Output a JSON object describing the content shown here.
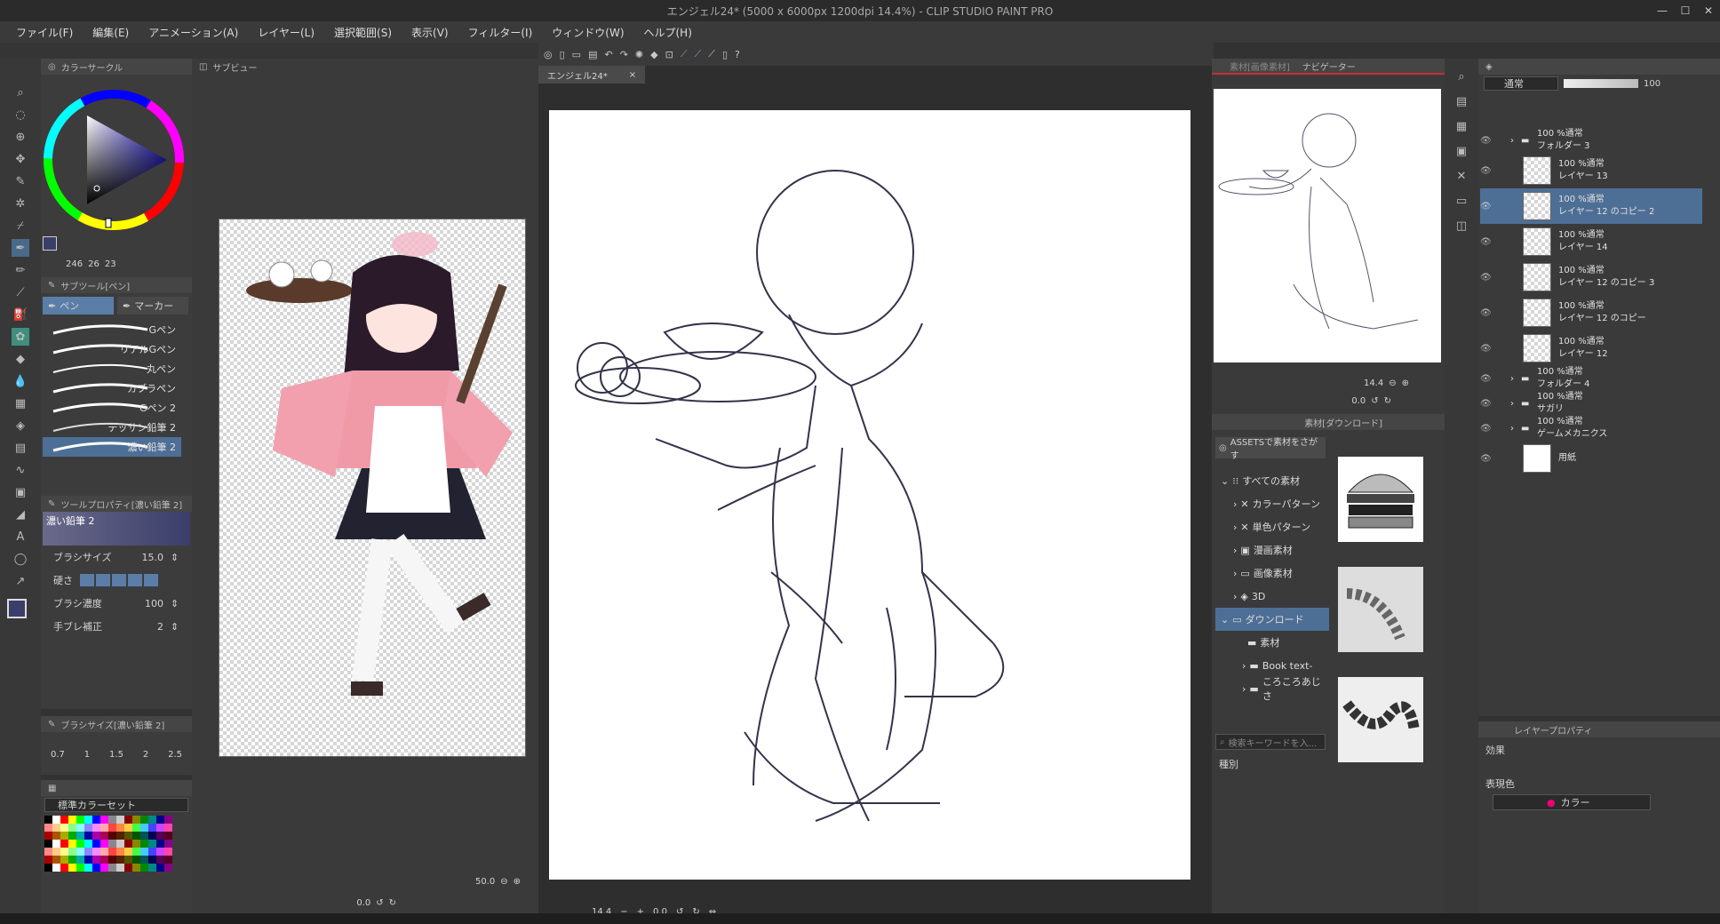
{
  "window": {
    "title": "エンジェル24* (5000 x 6000px 1200dpi 14.4%) - CLIP STUDIO PAINT PRO",
    "min": "—",
    "max": "☐",
    "close": "✕"
  },
  "menu": [
    "ファイル(F)",
    "編集(E)",
    "アニメーション(A)",
    "レイヤー(L)",
    "選択範囲(S)",
    "表示(V)",
    "フィルター(I)",
    "ウィンドウ(W)",
    "ヘルプ(H)"
  ],
  "color_circle": {
    "tab": "カラーサークル",
    "h": "246",
    "s": "26",
    "v": "23",
    "main_color": "#3a3e6a"
  },
  "sub_tool": {
    "tab": "サブツール[ペン]",
    "groups": [
      "ペン",
      "マーカー"
    ],
    "brushes": [
      "Gペン",
      "リアルGペン",
      "丸ペン",
      "カブラペン",
      "Gペン 2",
      "デッサン鉛筆 2",
      "濃い鉛筆 2"
    ],
    "selected": "濃い鉛筆 2"
  },
  "tool_property": {
    "tab": "ツールプロパティ[濃い鉛筆 2]",
    "name": "濃い鉛筆 2",
    "brush_size_label": "ブラシサイズ",
    "brush_size": "15.0",
    "hardness_label": "硬さ",
    "density_label": "ブラシ濃度",
    "density": "100",
    "stabilize_label": "手ブレ補正",
    "stabilize": "2"
  },
  "brush_size_panel": {
    "tab": "ブラシサイズ[濃い鉛筆 2]",
    "sizes": [
      "0.7",
      "1",
      "1.5",
      "2",
      "2.5"
    ]
  },
  "color_set": {
    "name": "標準カラーセット"
  },
  "sub_view": {
    "tab": "サブビュー",
    "zoom": "50.0",
    "angle": "0.0"
  },
  "canvas": {
    "tab": "エンジェル24*",
    "zoom": "14.4",
    "angle": "0.0"
  },
  "navigator": {
    "tabs": [
      "素材[画像素材]",
      "ナビゲーター"
    ],
    "zoom": "14.4",
    "angle": "0.0"
  },
  "material": {
    "tab": "素材[ダウンロード]",
    "assets_button": "ASSETSで素材をさがす",
    "tree": [
      "すべての素材",
      "カラーパターン",
      "単色パターン",
      "漫画素材",
      "画像素材",
      "3D",
      "ダウンロード",
      "素材",
      "Book text-",
      "ころころあじさ"
    ],
    "search_placeholder": "検索キーワードを入...",
    "type_label": "種別"
  },
  "layers": {
    "blend": "通常",
    "opacity": "100",
    "items": [
      {
        "mode": "100 %通常",
        "name": "フォルダー 3",
        "type": "folder"
      },
      {
        "mode": "100 %通常",
        "name": "レイヤー 13",
        "type": "layer"
      },
      {
        "mode": "100 %通常",
        "name": "レイヤー 12 のコピー 2",
        "type": "layer"
      },
      {
        "mode": "100 %通常",
        "name": "レイヤー 14",
        "type": "layer"
      },
      {
        "mode": "100 %通常",
        "name": "レイヤー 12 のコピー 3",
        "type": "layer"
      },
      {
        "mode": "100 %通常",
        "name": "レイヤー 12 のコピー",
        "type": "layer"
      },
      {
        "mode": "100 %通常",
        "name": "レイヤー 12",
        "type": "layer"
      },
      {
        "mode": "100 %通常",
        "name": "フォルダー 4",
        "type": "folder"
      },
      {
        "mode": "100 %通常",
        "name": "サガリ",
        "type": "folder"
      },
      {
        "mode": "100 %通常",
        "name": "ゲームメカニクス",
        "type": "folder"
      },
      {
        "mode": "",
        "name": "用紙",
        "type": "paper"
      }
    ]
  },
  "layer_property": {
    "tab": "レイヤープロパティ",
    "effect_label": "効果",
    "expression_label": "表現色",
    "expression_value": "カラー"
  }
}
